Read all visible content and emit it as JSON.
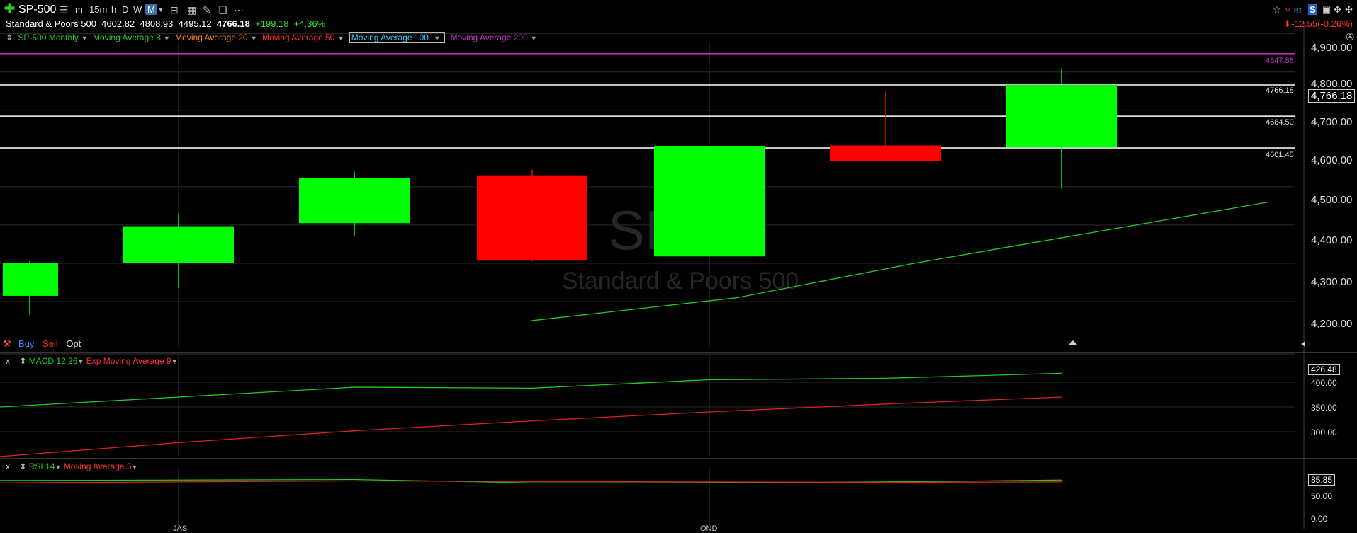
{
  "toolbar": {
    "symbol": "SP-500",
    "timeframes": [
      "m",
      "15m",
      "h",
      "D",
      "W",
      "M"
    ],
    "active_timeframe": "M",
    "right_badges": [
      "RT",
      "S"
    ]
  },
  "quote": {
    "name": "Standard & Poors 500",
    "open": "4602.82",
    "high": "4808.93",
    "low": "4495.12",
    "last": "4766.18",
    "change": "+199.18",
    "change_pct": "+4.36%",
    "day_change": "-12.55(-0.26%)"
  },
  "legend": {
    "main": "SP-500 Monthly",
    "ma8": "Moving Average 8",
    "ma20": "Moving Average 20",
    "ma50": "Moving Average 50",
    "ma100": "Moving Average 100",
    "ma200": "Moving Average 200"
  },
  "colors": {
    "up": "#00ff00",
    "down": "#ff0000",
    "ma8": "#22cc22",
    "ma20": "#ff8c1a",
    "ma50": "#ff2a2a",
    "ma100": "#33ccff",
    "ma200": "#cc33cc",
    "macd": "#22cc22",
    "signal": "#dd2222"
  },
  "watermark": {
    "symbol": "SP",
    "name": "Standard & Poors 500"
  },
  "trade": {
    "buy": "Buy",
    "sell": "Sell",
    "opt": "Opt"
  },
  "price_axis": {
    "ticks": [
      "4,900.00",
      "4,800.00",
      "4,700.00",
      "4,600.00",
      "4,500.00",
      "4,400.00",
      "4,300.00",
      "4,200.00"
    ],
    "last_label": "4,766.18"
  },
  "level_lines": [
    {
      "value": 4847.86,
      "label": "4847.86",
      "color": "#cc33cc"
    },
    {
      "value": 4766.18,
      "label": "4766.18",
      "color": "#ffffff"
    },
    {
      "value": 4684.5,
      "label": "4684.50",
      "color": "#ffffff"
    },
    {
      "value": 4601.45,
      "label": "4601.45",
      "color": "#ffffff"
    }
  ],
  "macd_pane": {
    "close": "x",
    "title": "MACD 12 26",
    "signal_title": "Exp Moving Average 9",
    "ticks": [
      "400.00",
      "350.00",
      "300.00"
    ],
    "last_label": "426.48"
  },
  "rsi_pane": {
    "close": "x",
    "title": "RSI 14",
    "avg_title": "Moving Average 5",
    "ticks": [
      "50.00",
      "0.00"
    ],
    "last_label": "85.85"
  },
  "x_axis": {
    "labels": [
      "JAS",
      "OND"
    ]
  },
  "chart_data": {
    "type": "candlestick",
    "ylim": [
      4150,
      4930
    ],
    "candles": [
      {
        "o": 4215,
        "h": 4305,
        "l": 4165,
        "c": 4300
      },
      {
        "o": 4300,
        "h": 4430,
        "l": 4235,
        "c": 4397
      },
      {
        "o": 4405,
        "h": 4540,
        "l": 4370,
        "c": 4522
      },
      {
        "o": 4530,
        "h": 4545,
        "l": 4305,
        "c": 4307
      },
      {
        "o": 4318,
        "h": 4607,
        "l": 4318,
        "c": 4607
      },
      {
        "o": 4608,
        "h": 4750,
        "l": 4570,
        "c": 4568
      },
      {
        "o": 4602.82,
        "h": 4808.93,
        "l": 4495.12,
        "c": 4766.18
      }
    ],
    "ma8": [
      null,
      null,
      null,
      4150,
      4210,
      4300,
      4380,
      4460
    ],
    "macd": {
      "ylim": [
        240,
        440
      ],
      "macd": [
        350,
        370,
        390,
        388,
        405,
        408,
        418
      ],
      "signal": [
        250,
        278,
        302,
        322,
        340,
        356,
        370
      ]
    },
    "rsi": {
      "ylim": [
        0,
        100
      ],
      "rsi": [
        85,
        86,
        87,
        80,
        80,
        82,
        86
      ],
      "avg": [
        80,
        82,
        84,
        83,
        82,
        81,
        82
      ]
    }
  }
}
